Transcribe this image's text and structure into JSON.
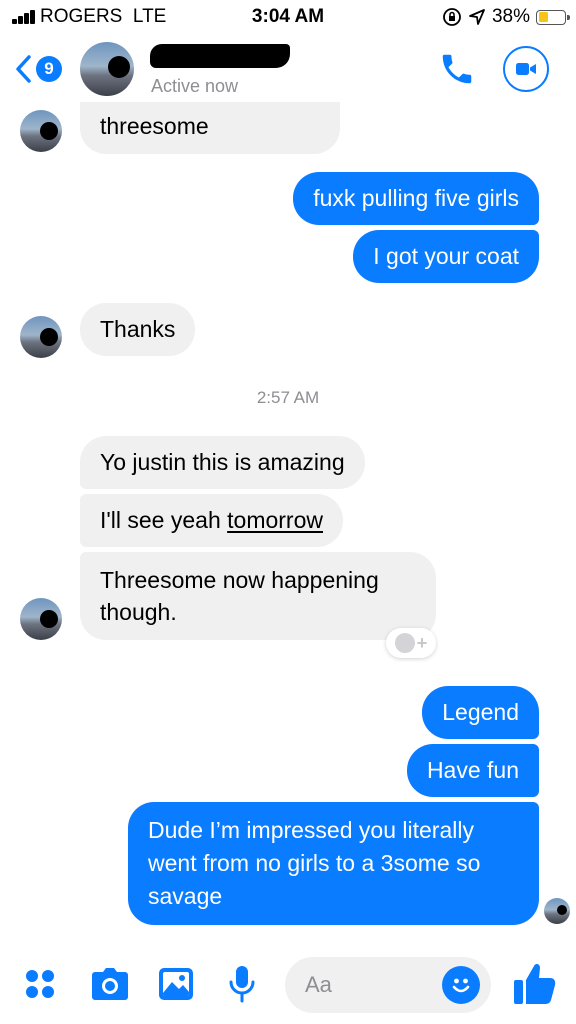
{
  "status_bar": {
    "carrier": "ROGERS",
    "network": "LTE",
    "time": "3:04 AM",
    "battery": "38%",
    "battery_level": 0.38,
    "icons": [
      "signal-bars-icon",
      "orientation-lock-icon",
      "location-arrow-icon",
      "battery-icon"
    ]
  },
  "header": {
    "back_badge": "9",
    "status": "Active now",
    "icons": [
      "back-chevron-icon",
      "phone-icon",
      "video-camera-icon"
    ]
  },
  "messages": [
    {
      "from": "them",
      "text": "threesome"
    },
    {
      "from": "me",
      "text": "fuxk pulling five girls"
    },
    {
      "from": "me",
      "text": "I got your coat"
    },
    {
      "from": "them",
      "text": "Thanks"
    },
    {
      "from": "them",
      "text_a": "Yo justin this is amazing"
    },
    {
      "from": "them",
      "text_a": "I'll see yeah ",
      "link": "tomorrow"
    },
    {
      "from": "them",
      "text": "Threesome now happening though."
    },
    {
      "from": "me",
      "text": "Legend"
    },
    {
      "from": "me",
      "text": "Have fun"
    },
    {
      "from": "me",
      "text": "Dude I’m impressed you literally went from no girls to a 3some so savage"
    }
  ],
  "timestamp": "2:57 AM",
  "composer": {
    "placeholder": "Aa",
    "icons": [
      "apps-grid-icon",
      "camera-icon",
      "photo-gallery-icon",
      "microphone-icon",
      "emoji-icon",
      "thumbs-up-icon"
    ]
  },
  "colors": {
    "accent": "#0a7cff",
    "incoming_bubble": "#f0f0f0",
    "secondary_text": "#8e8e93"
  }
}
